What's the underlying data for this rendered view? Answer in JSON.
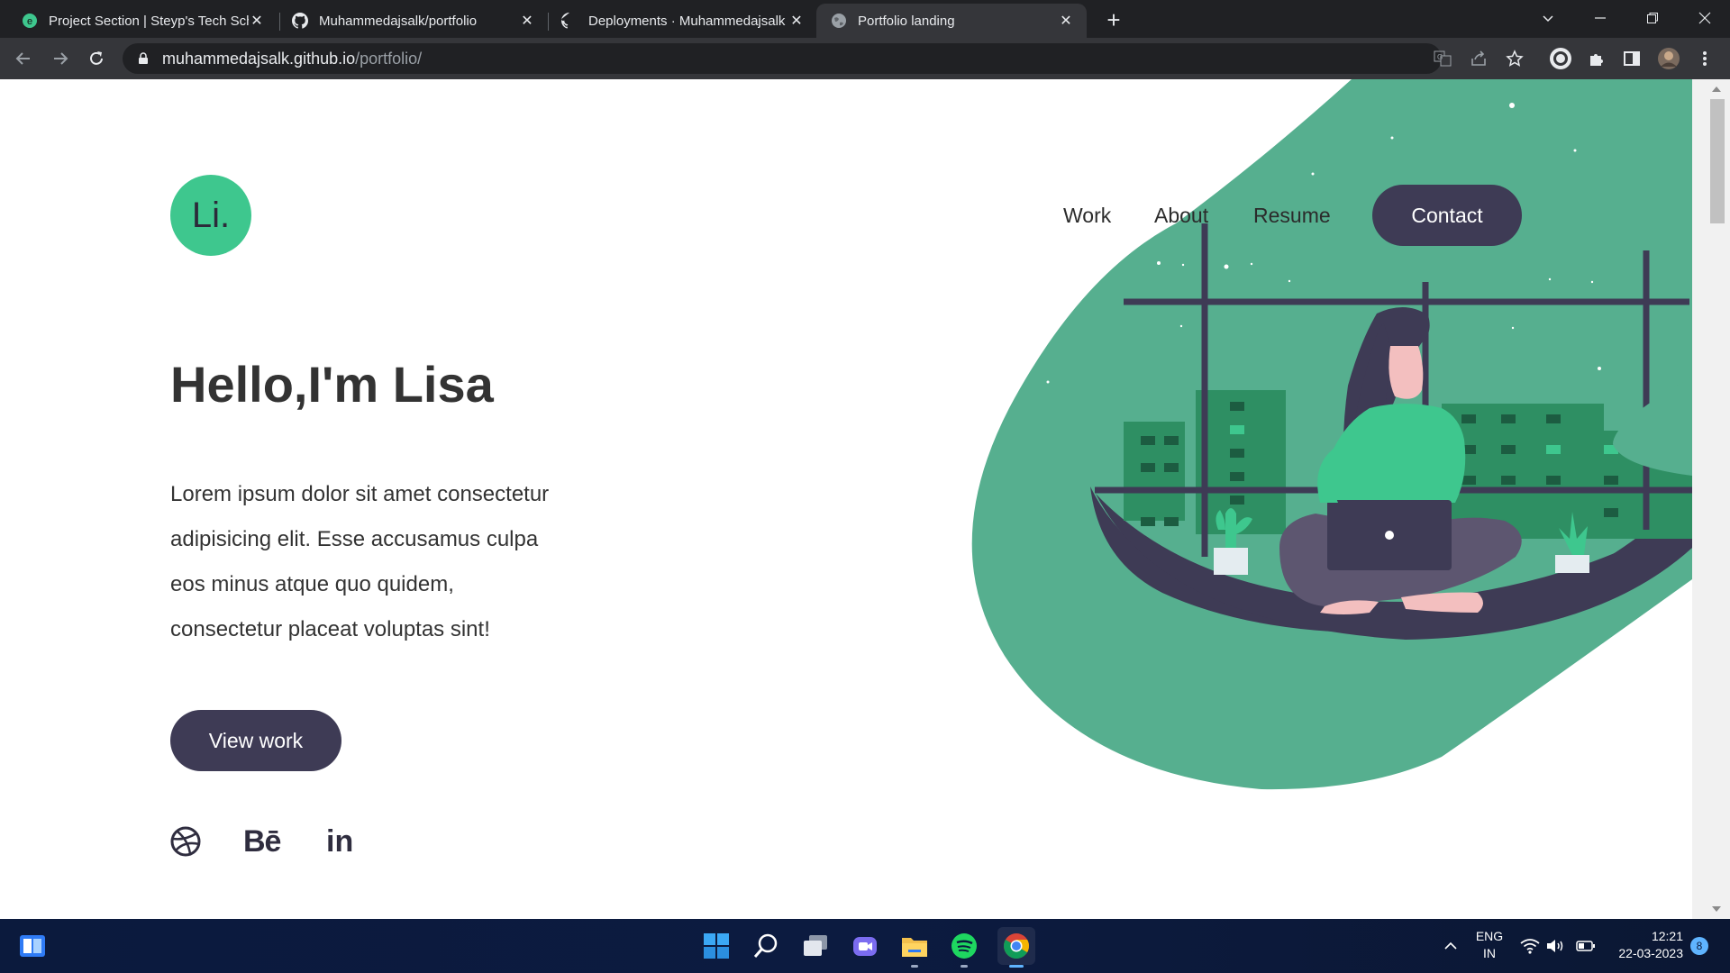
{
  "browser": {
    "tabs": [
      {
        "title": "Project Section | Steyp's Tech Sch",
        "icon": "steyp-favicon"
      },
      {
        "title": "Muhammedajsalk/portfolio",
        "icon": "github-icon"
      },
      {
        "title": "Deployments · Muhammedajsalk",
        "icon": "github-icon"
      },
      {
        "title": "Portfolio landing",
        "icon": "globe-icon",
        "active": true
      }
    ],
    "url_host": "muhammedajsalk.github.io",
    "url_path": "/portfolio/"
  },
  "page": {
    "logo_text": "Li.",
    "nav": {
      "work": "Work",
      "about": "About",
      "resume": "Resume",
      "contact": "Contact"
    },
    "heading": "Hello,I'm Lisa",
    "intro_lines": [
      "Lorem ipsum dolor sit amet consectetur",
      "adipisicing elit. Esse accusamus culpa",
      "eos minus atque quo quidem,",
      "consectetur placeat voluptas sint!"
    ],
    "view_work": "View work",
    "social": {
      "behance": "Bē",
      "linkedin": "in"
    },
    "colors": {
      "accent": "#3ec78e",
      "blob": "#56af8f",
      "dark": "#3e3b55"
    }
  },
  "taskbar": {
    "language": "ENG",
    "region": "IN",
    "time": "12:21",
    "date": "22-03-2023",
    "notification_count": "8"
  }
}
